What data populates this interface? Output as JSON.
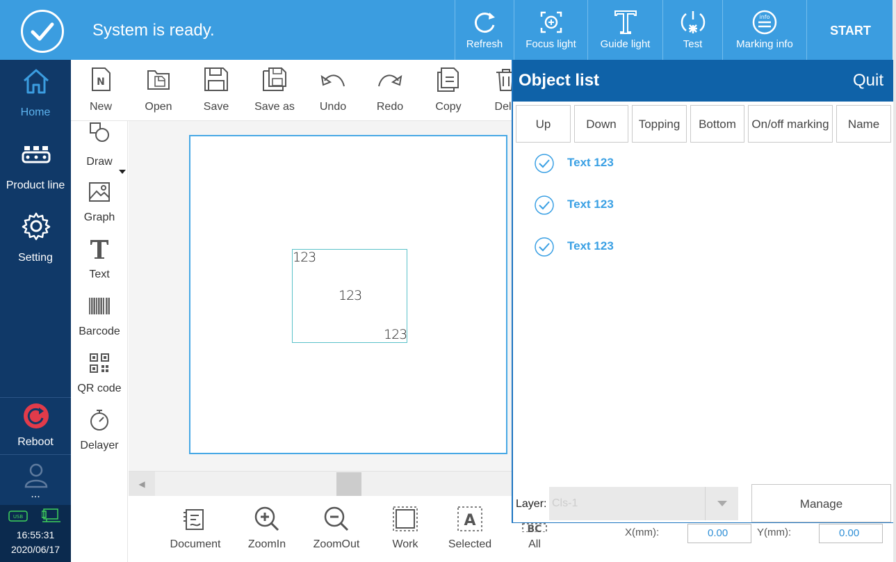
{
  "colors": {
    "topbar": "#3b9de0",
    "sidebar": "#103968",
    "panel_header": "#0f62a8",
    "accent": "#3aa0e4",
    "reboot": "#e23b4a"
  },
  "status": {
    "message": "System is ready.",
    "icon": "check-circle-icon"
  },
  "top_actions": [
    {
      "label": "Refresh",
      "icon": "refresh-icon"
    },
    {
      "label": "Focus light",
      "icon": "focus-light-icon"
    },
    {
      "label": "Guide light",
      "icon": "guide-light-icon"
    },
    {
      "label": "Test",
      "icon": "test-icon"
    },
    {
      "label": "Marking info",
      "icon": "marking-info-icon"
    }
  ],
  "start_label": "START",
  "nav": {
    "home": "Home",
    "product_line": "Product line",
    "setting": "Setting",
    "reboot": "Reboot",
    "user": "...",
    "time": "16:55:31",
    "date": "2020/06/17"
  },
  "toolbar": [
    {
      "label": "New",
      "icon": "new-file-icon"
    },
    {
      "label": "Open",
      "icon": "open-folder-icon"
    },
    {
      "label": "Save",
      "icon": "save-icon"
    },
    {
      "label": "Save as",
      "icon": "save-as-icon"
    },
    {
      "label": "Undo",
      "icon": "undo-icon"
    },
    {
      "label": "Redo",
      "icon": "redo-icon"
    },
    {
      "label": "Copy",
      "icon": "copy-icon"
    },
    {
      "label": "Dele",
      "icon": "delete-icon"
    }
  ],
  "palette": [
    {
      "label": "Draw",
      "icon": "draw-shapes-icon"
    },
    {
      "label": "Graph",
      "icon": "image-icon"
    },
    {
      "label": "Text",
      "icon": "text-icon"
    },
    {
      "label": "Barcode",
      "icon": "barcode-icon"
    },
    {
      "label": "QR code",
      "icon": "qr-code-icon"
    },
    {
      "label": "Delayer",
      "icon": "timer-icon"
    }
  ],
  "canvas": {
    "texts": [
      "123",
      "123",
      "123"
    ]
  },
  "bottom_tools": [
    {
      "label": "Document",
      "icon": "document-icon"
    },
    {
      "label": "ZoomIn",
      "icon": "zoom-in-icon"
    },
    {
      "label": "ZoomOut",
      "icon": "zoom-out-icon"
    },
    {
      "label": "Work",
      "icon": "work-area-icon"
    },
    {
      "label": "Selected",
      "icon": "selected-icon"
    },
    {
      "label": "All",
      "icon": "select-all-icon"
    }
  ],
  "coords": {
    "x_label": "X(mm):",
    "x_value": "0.00",
    "y_label": "Y(mm):",
    "y_value": "0.00"
  },
  "object_list": {
    "title": "Object list",
    "quit": "Quit",
    "buttons": [
      "Up",
      "Down",
      "Topping",
      "Bottom",
      "On/off marking",
      "Name"
    ],
    "items": [
      {
        "name": "Text 123",
        "checked": true
      },
      {
        "name": "Text 123",
        "checked": true
      },
      {
        "name": "Text 123",
        "checked": true
      }
    ],
    "layer_label": "Layer:",
    "layer_value": "Cls-1",
    "manage": "Manage"
  }
}
